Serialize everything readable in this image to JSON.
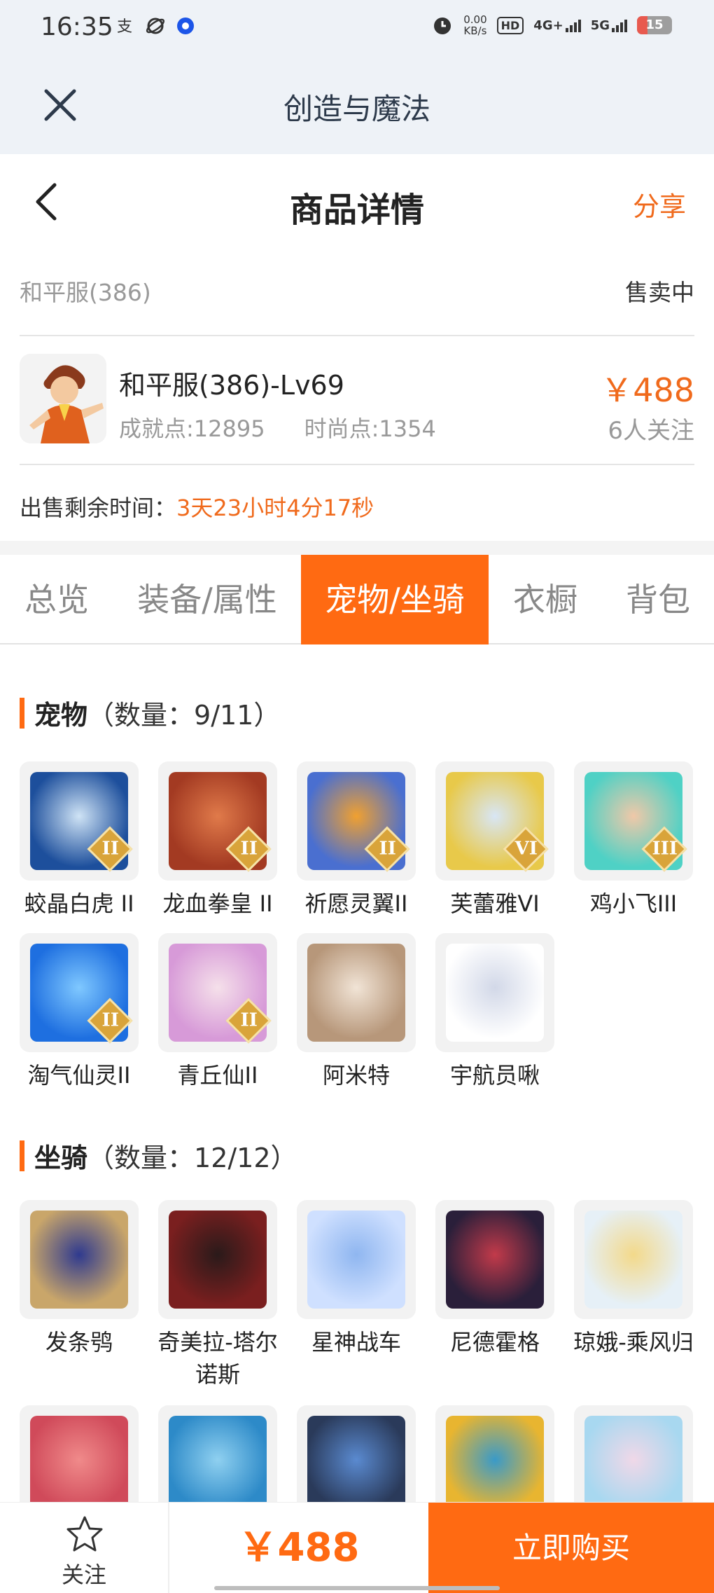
{
  "status_bar": {
    "time": "16:35",
    "speed_value": "0.00",
    "speed_unit": "KB/s",
    "hd_label": "HD",
    "net1": "4G+",
    "net2": "5G",
    "battery": "15"
  },
  "app": {
    "title": "创造与魔法"
  },
  "header": {
    "title": "商品详情",
    "share": "分享"
  },
  "listing": {
    "server": "和平服(386)",
    "status": "售卖中",
    "name": "和平服(386)-Lv69",
    "achievement": "成就点:12895",
    "fashion": "时尚点:1354",
    "price": "￥488",
    "followers": "6人关注",
    "remain_label": "出售剩余时间：",
    "remain_value": "3天23小时4分17秒"
  },
  "tabs": [
    {
      "label": "总览",
      "active": false
    },
    {
      "label": "装备/属性",
      "active": false
    },
    {
      "label": "宠物/坐骑",
      "active": true
    },
    {
      "label": "衣橱",
      "active": false
    },
    {
      "label": "背包",
      "active": false
    }
  ],
  "pets": {
    "title": "宠物",
    "count": "（数量：9/11）",
    "items": [
      {
        "name": "蛟晶白虎 II",
        "rank": "II",
        "colors": [
          "#1d4f9c",
          "#cfe3f5"
        ]
      },
      {
        "name": "龙血拳皇 II",
        "rank": "II",
        "colors": [
          "#a33a22",
          "#e07a4a"
        ]
      },
      {
        "name": "祈愿灵翼II",
        "rank": "II",
        "colors": [
          "#4a6fd0",
          "#f0a030"
        ]
      },
      {
        "name": "芙蕾雅VI",
        "rank": "VI",
        "colors": [
          "#e8c94a",
          "#d8e6f5"
        ]
      },
      {
        "name": "鸡小飞III",
        "rank": "III",
        "colors": [
          "#4fd1c5",
          "#f0c8a8"
        ]
      },
      {
        "name": "淘气仙灵II",
        "rank": "II",
        "colors": [
          "#1e6fe0",
          "#7fc8ff"
        ]
      },
      {
        "name": "青丘仙II",
        "rank": "II",
        "colors": [
          "#d79ad8",
          "#f5e0ea"
        ]
      },
      {
        "name": "阿米特",
        "rank": "",
        "colors": [
          "#b7977a",
          "#f1e4d6"
        ]
      },
      {
        "name": "宇航员啾",
        "rank": "",
        "colors": [
          "#ffffff",
          "#d2d8e8"
        ]
      }
    ]
  },
  "mounts": {
    "title": "坐骑",
    "count": "（数量：12/12）",
    "items": [
      {
        "name": "发条鸮",
        "colors": [
          "#c9a66a",
          "#2f3a8f"
        ]
      },
      {
        "name": "奇美拉-塔尔诺斯",
        "colors": [
          "#7a1f1f",
          "#2a1a1a"
        ]
      },
      {
        "name": "星神战车",
        "colors": [
          "#cfe0ff",
          "#8fb6f0"
        ]
      },
      {
        "name": "尼德霍格",
        "colors": [
          "#2a1f3a",
          "#c23a4a"
        ]
      },
      {
        "name": "琼娥-乘风归",
        "colors": [
          "#e6f0f7",
          "#f3d98a"
        ]
      },
      {
        "name": "",
        "colors": [
          "#d04a5a",
          "#f08a8a"
        ]
      },
      {
        "name": "",
        "colors": [
          "#2d8ac8",
          "#8fd0f0"
        ]
      },
      {
        "name": "",
        "colors": [
          "#2a3a5a",
          "#5a8ad0"
        ]
      },
      {
        "name": "",
        "colors": [
          "#e8b530",
          "#3a9ac8"
        ]
      },
      {
        "name": "",
        "colors": [
          "#a8d8f0",
          "#f0d8e8"
        ]
      }
    ]
  },
  "bottom": {
    "follow": "关注",
    "price": "￥488",
    "buy": "立即购买"
  }
}
